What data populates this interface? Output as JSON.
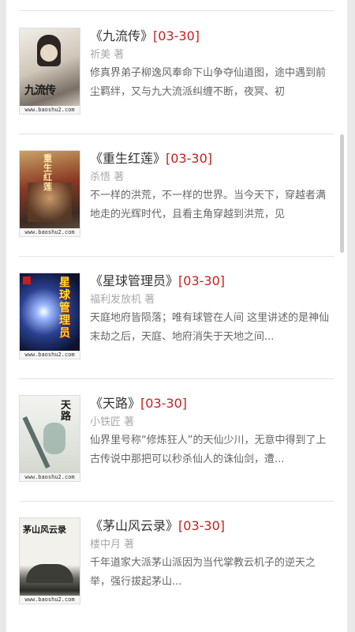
{
  "list": {
    "items": [
      {
        "title": "《九流传》",
        "date": "[03-30]",
        "author": "祈美 著",
        "desc": "修真界弟子柳逸风奉命下山争夺仙道图，途中遇到前尘羁绊，又与九大流派纠缠不断，夜冥、初",
        "cover": {
          "title_text": "九流传",
          "watermark": "www.baoshu2.com",
          "bg": "#e5e0d6"
        }
      },
      {
        "title": "《重生红莲》",
        "date": "[03-30]",
        "author": "杀悟 著",
        "desc": "不一样的洪荒，不一样的世界。当今天下，穿越者满地走的光辉时代，且看主角穿越到洪荒，见",
        "cover": {
          "title_text": "重生红莲",
          "watermark": "www.baoshu2.com",
          "bg": "#8a3a24"
        }
      },
      {
        "title": "《星球管理员》",
        "date": "[03-30]",
        "author": "福利发放机 著",
        "desc": "天庭地府皆陨落；唯有球管在人间 这里讲述的是神仙末劫之后，天庭、地府消失于天地之间...",
        "cover": {
          "title_text": "星球管理员",
          "watermark": "www.baoshu2.com",
          "bg": "#1b2f6b"
        }
      },
      {
        "title": "《天路》",
        "date": "[03-30]",
        "author": "小铁匠 著",
        "desc": "仙界里号称“修炼狂人”的天仙少川，无意中得到了上古传说中那把可以秒杀仙人的诛仙剑，遭...",
        "cover": {
          "title_text": "天路",
          "watermark": "www.baoshu2.com",
          "bg": "#e9ece6"
        }
      },
      {
        "title": "《茅山风云录》",
        "date": "[03-30]",
        "author": "楼中月 著",
        "desc": "千年道家大派茅山派因为当代掌教云机子的逆天之举，强行拔起茅山...",
        "cover": {
          "title_text": "茅山风云录",
          "watermark": "www.baoshu2.com",
          "bg": "#f1f0ec"
        }
      }
    ]
  }
}
